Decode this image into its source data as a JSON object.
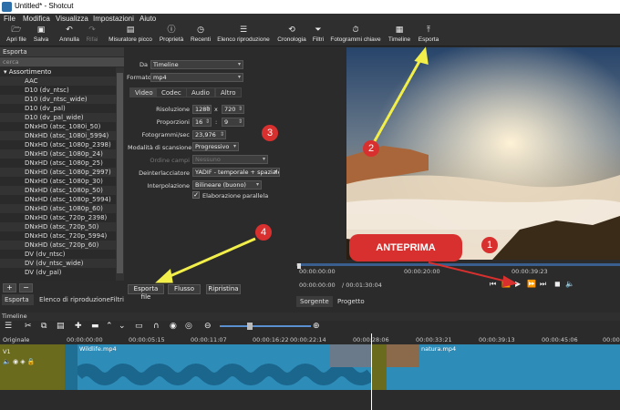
{
  "window": {
    "title": "Untitled* - Shotcut"
  },
  "menu": [
    "File",
    "Modifica",
    "Visualizza",
    "Impostazioni",
    "Aiuto"
  ],
  "toolbar": [
    {
      "label": "Apri file",
      "icon": "folder-icon"
    },
    {
      "label": "Salva",
      "icon": "save-icon"
    },
    {
      "label": "Annulla",
      "icon": "undo-icon"
    },
    {
      "label": "Rifai",
      "icon": "redo-icon"
    },
    {
      "label": "Misuratore picco",
      "icon": "meter-icon"
    },
    {
      "label": "Proprietà",
      "icon": "info-icon"
    },
    {
      "label": "Recenti",
      "icon": "clock-icon"
    },
    {
      "label": "Elenco riproduzione",
      "icon": "list-icon"
    },
    {
      "label": "Cronologia",
      "icon": "history-icon"
    },
    {
      "label": "Filtri",
      "icon": "filter-icon"
    },
    {
      "label": "Fotogrammi chiave",
      "icon": "stopwatch-icon"
    },
    {
      "label": "Timeline",
      "icon": "timeline-icon"
    },
    {
      "label": "Esporta",
      "icon": "export-icon"
    }
  ],
  "export_panel": {
    "title": "Esporta",
    "search_placeholder": "cerca",
    "category": "Assortimento",
    "items": [
      "AAC",
      "D10 (dv_ntsc)",
      "D10 (dv_ntsc_wide)",
      "D10 (dv_pal)",
      "D10 (dv_pal_wide)",
      "DNxHD (atsc_1080i_50)",
      "DNxHD (atsc_1080i_5994)",
      "DNxHD (atsc_1080p_2398)",
      "DNxHD (atsc_1080p_24)",
      "DNxHD (atsc_1080p_25)",
      "DNxHD (atsc_1080p_2997)",
      "DNxHD (atsc_1080p_30)",
      "DNxHD (atsc_1080p_50)",
      "DNxHD (atsc_1080p_5994)",
      "DNxHD (atsc_1080p_60)",
      "DNxHD (atsc_720p_2398)",
      "DNxHD (atsc_720p_50)",
      "DNxHD (atsc_720p_5994)",
      "DNxHD (atsc_720p_60)",
      "DV (dv_ntsc)",
      "DV (dv_ntsc_wide)",
      "DV (dv_pal)"
    ],
    "add_label": "+",
    "remove_label": "−",
    "bottom_tabs": [
      "Esporta",
      "Elenco di riproduzione",
      "Filtri"
    ]
  },
  "settings": {
    "from_label": "Da",
    "from_value": "Timeline",
    "format_label": "Formato",
    "format_value": "mp4",
    "tabs": [
      "Video",
      "Codec",
      "Audio",
      "Altro"
    ],
    "resolution_label": "Risoluzione",
    "res_w": "1280",
    "res_h": "720",
    "aspect_label": "Proporzioni",
    "aspect_w": "16",
    "aspect_h": "9",
    "fps_label": "Fotogrammi/sec",
    "fps_value": "23,976",
    "scan_label": "Modalità di scansione",
    "scan_value": "Progressivo",
    "field_label": "Ordine campi",
    "field_value": "Nessuno",
    "deint_label": "Deinterlacciatore",
    "deint_value": "YADIF - temporale + spaziale",
    "interp_label": "Interpolazione",
    "interp_value": "Bilineare (buono)",
    "parallel_label": "Elaborazione parallela",
    "times": "x",
    "colon": ":",
    "export_button": "Esporta file",
    "stream_button": "Flusso",
    "reset_button": "Ripristina"
  },
  "player": {
    "ruler_ticks": [
      "00:00:00:00",
      "00:00:20:00",
      "00:00:39:23"
    ],
    "position": "00:00:00:00",
    "duration": "/ 00:01:30:04",
    "tabs": [
      "Sorgente",
      "Progetto"
    ]
  },
  "timeline": {
    "title": "Timeline",
    "track_header": "Originale",
    "track_name": "V1",
    "ticks": [
      "00:00:00:00",
      "00:00:05:15",
      "00:00:11:07",
      "00:00:16:22",
      "00:00:22:14",
      "00:00:28:06",
      "00:00:33:21",
      "00:00:39:13",
      "00:00:45:06",
      "00:00:5"
    ],
    "clips": [
      "Wildlife.mp4",
      "natura.mp4"
    ]
  },
  "annotations": {
    "preview_label": "ANTEPRIMA",
    "b1": "1",
    "b2": "2",
    "b3": "3",
    "b4": "4",
    "color": "#d8302e",
    "arrow_color": "#f2ee4a"
  }
}
